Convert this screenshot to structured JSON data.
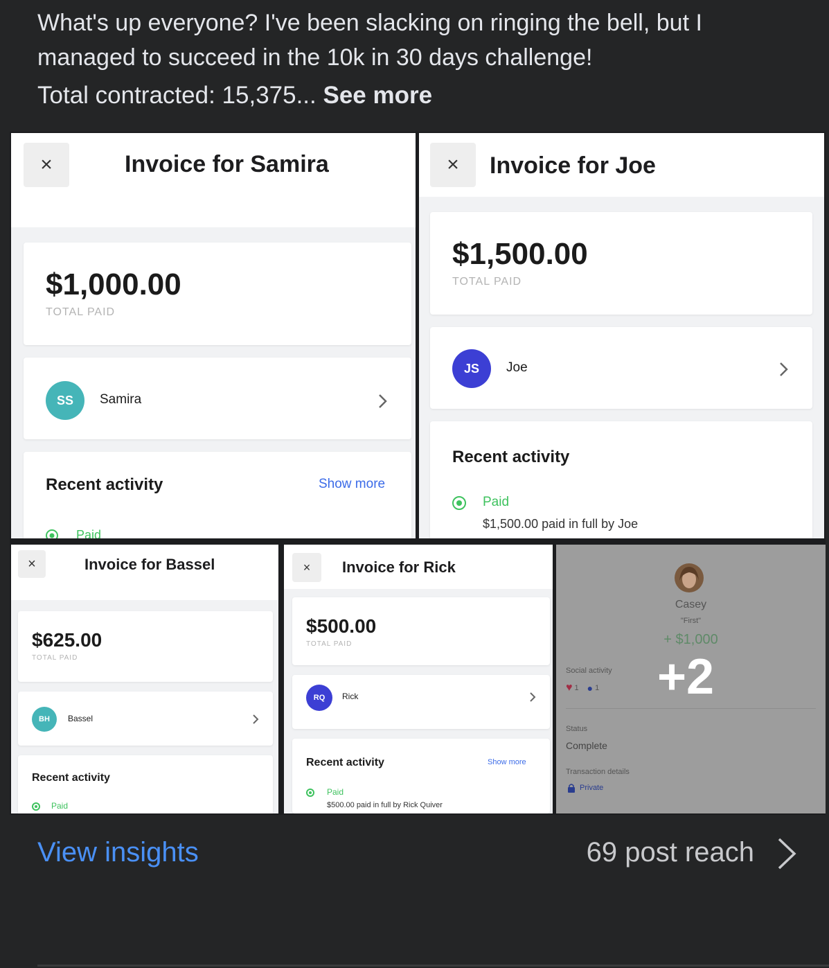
{
  "post": {
    "text": "What's up everyone? I've been slacking on ringing the bell, but I managed to succeed in the 10k in 30 days challenge!",
    "total_prefix": "Total contracted: 15,375... ",
    "see_more": "See more"
  },
  "invoices": {
    "samira": {
      "close": "×",
      "title": "Invoice for Samira",
      "amount": "$1,000.00",
      "total_paid": "TOTAL PAID",
      "initials": "SS",
      "name": "Samira",
      "avatar_color": "#45b5b8",
      "recent_activity": "Recent activity",
      "show_more": "Show more",
      "paid": "Paid"
    },
    "joe": {
      "close": "×",
      "title": "Invoice for Joe",
      "amount": "$1,500.00",
      "total_paid": "TOTAL PAID",
      "initials": "JS",
      "name": "Joe",
      "avatar_color": "#3c3fd4",
      "recent_activity": "Recent activity",
      "paid": "Paid",
      "paid_desc": "$1,500.00 paid in full by Joe"
    },
    "bassel": {
      "close": "×",
      "title": "Invoice for Bassel",
      "amount": "$625.00",
      "total_paid": "TOTAL PAID",
      "initials": "BH",
      "name": "Bassel",
      "avatar_color": "#45b5b8",
      "recent_activity": "Recent activity",
      "paid": "Paid"
    },
    "rick": {
      "close": "×",
      "title": "Invoice for Rick",
      "amount": "$500.00",
      "total_paid": "TOTAL PAID",
      "initials": "RQ",
      "name": "Rick",
      "avatar_color": "#3c3fd4",
      "recent_activity": "Recent activity",
      "show_more": "Show more",
      "paid": "Paid",
      "paid_desc": "$500.00 paid in full by Rick Quiver"
    }
  },
  "casey": {
    "name": "Casey",
    "note": "\"First\"",
    "amount": "+ $1,000",
    "social_activity": "Social activity",
    "likes": "1",
    "comments": "1",
    "status_label": "Status",
    "status_value": "Complete",
    "transaction_label": "Transaction details",
    "privacy": "Private",
    "more_count": "+2"
  },
  "footer": {
    "view_insights": "View insights",
    "post_reach": "69 post reach"
  },
  "colors": {
    "link": "#4a90f5",
    "paid_green": "#3ec25e",
    "background": "#242526"
  }
}
